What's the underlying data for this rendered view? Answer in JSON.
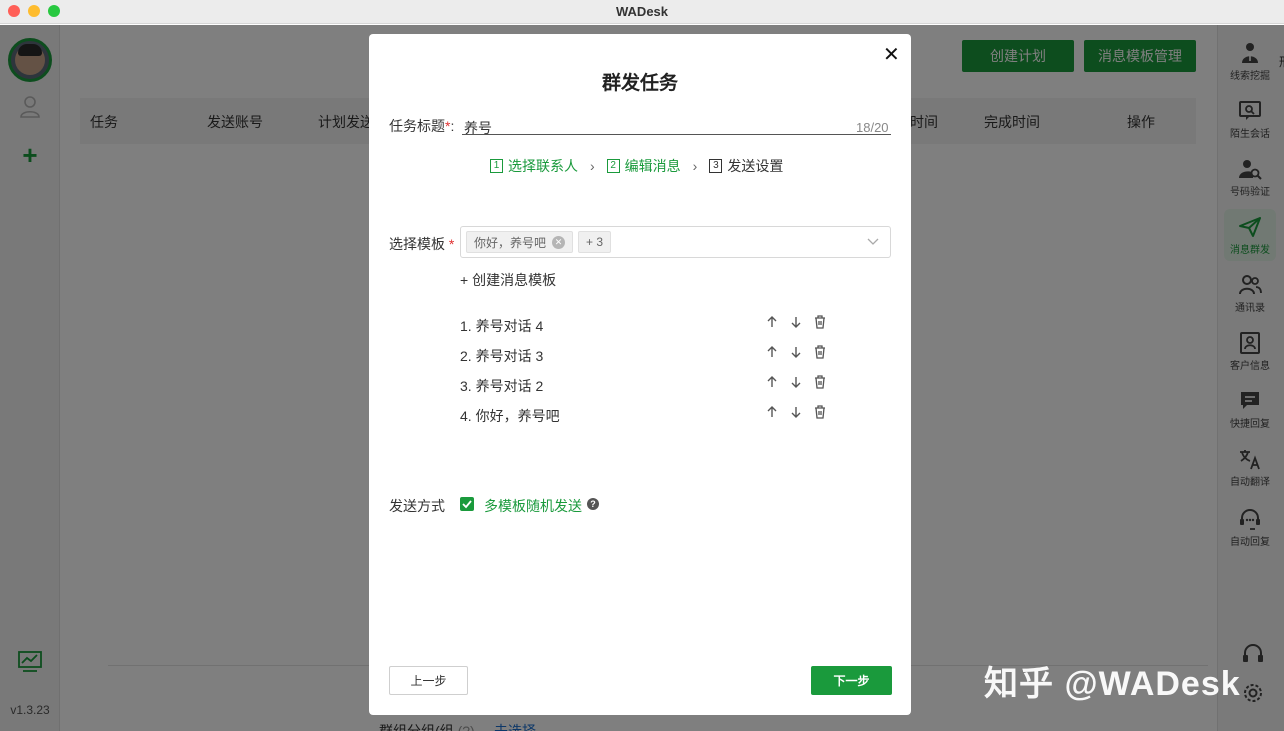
{
  "window": {
    "title": "WADesk"
  },
  "left_sidebar": {
    "version": "v1.3.23"
  },
  "main": {
    "create_plan_label": "创建计划",
    "template_mgmt_label": "消息模板管理",
    "table_headers": [
      "任务",
      "发送账号",
      "计划发送",
      "时间",
      "完成时间",
      "操作"
    ],
    "bottom_label": "群组分组(组",
    "bottom_hint": "(?)",
    "bottom_link": "未选择"
  },
  "right_sidebar": {
    "items": [
      {
        "label": "线索挖掘",
        "icon": "person-upload-icon"
      },
      {
        "label": "陌生会话",
        "icon": "chat-search-icon"
      },
      {
        "label": "号码验证",
        "icon": "person-search-icon"
      },
      {
        "label": "消息群发",
        "icon": "send-icon",
        "active": true
      },
      {
        "label": "通讯录",
        "icon": "contacts-icon"
      },
      {
        "label": "客户信息",
        "icon": "customer-card-icon"
      },
      {
        "label": "快捷回复",
        "icon": "quick-reply-icon"
      },
      {
        "label": "自动翻译",
        "icon": "translate-icon"
      },
      {
        "label": "自动回复",
        "icon": "auto-reply-icon"
      }
    ],
    "edge_text": "刑"
  },
  "modal": {
    "title": "群发任务",
    "task_title_label": "任务标题",
    "task_title_value": "养号",
    "task_title_count": "18/20",
    "steps": [
      {
        "num": "1",
        "label": "选择联系人",
        "state": "done"
      },
      {
        "num": "2",
        "label": "编辑消息",
        "state": "done"
      },
      {
        "num": "3",
        "label": "发送设置",
        "state": "todo"
      }
    ],
    "select_template_label": "选择模板",
    "selected_chips": [
      "你好，养号吧",
      "+ 3"
    ],
    "create_template_link": "+ 创建消息模板",
    "templates": [
      "1. 养号对话 4",
      "2. 养号对话 3",
      "3. 养号对话 2",
      "4. 你好，养号吧"
    ],
    "send_method_label": "发送方式",
    "multi_template_label": "多模板随机发送",
    "prev_label": "上一步",
    "next_label": "下一步"
  },
  "watermark": "知乎 @WADesk",
  "colors": {
    "brand_green": "#1a9a3c",
    "required_red": "#e03131"
  }
}
